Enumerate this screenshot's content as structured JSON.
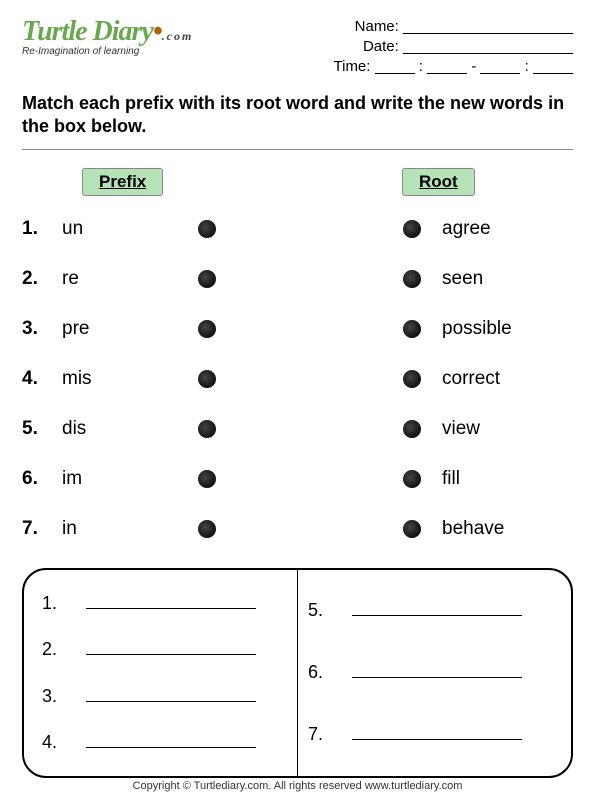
{
  "brand": {
    "name": "Turtle Diary",
    "suffix": ".com",
    "tagline": "Re-Imagination of learning"
  },
  "fields": {
    "name": "Name:",
    "date": "Date:",
    "time": "Time:",
    "colon": ":",
    "dash": "-"
  },
  "instructions": "Match each prefix with its root word and write the new words in the box below.",
  "headers": {
    "prefix": "Prefix",
    "root": "Root"
  },
  "items": [
    {
      "n": "1.",
      "prefix": "un",
      "root": "agree"
    },
    {
      "n": "2.",
      "prefix": "re",
      "root": "seen"
    },
    {
      "n": "3.",
      "prefix": "pre",
      "root": "possible"
    },
    {
      "n": "4.",
      "prefix": "mis",
      "root": "correct"
    },
    {
      "n": "5.",
      "prefix": "dis",
      "root": "view"
    },
    {
      "n": "6.",
      "prefix": "im",
      "root": "fill"
    },
    {
      "n": "7.",
      "prefix": "in",
      "root": "behave"
    }
  ],
  "answers_left": [
    "1.",
    "2.",
    "3.",
    "4."
  ],
  "answers_right": [
    "5.",
    "6.",
    "7."
  ],
  "footer": "Copyright © Turtlediary.com. All rights reserved  www.turtlediary.com"
}
